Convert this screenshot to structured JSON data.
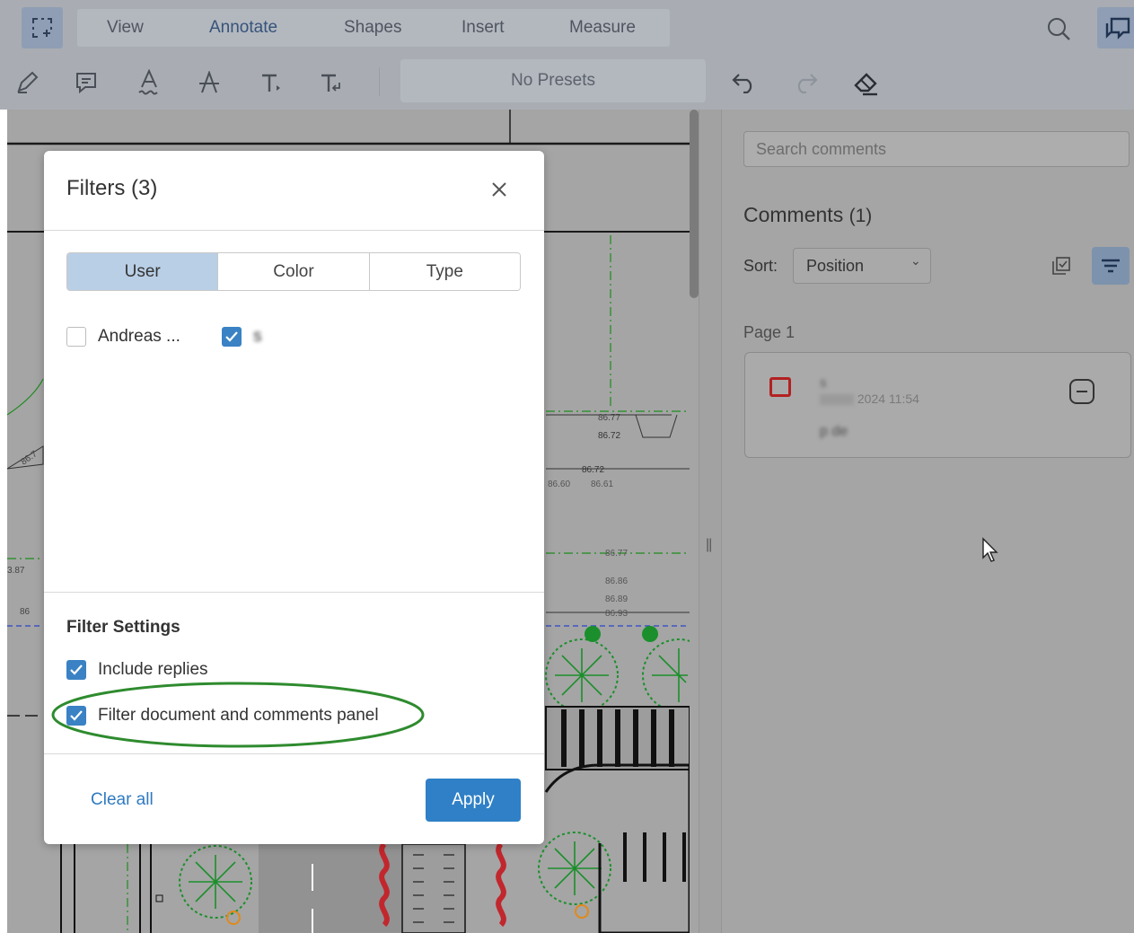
{
  "toolbar": {
    "menu": [
      "View",
      "Annotate",
      "Shapes",
      "Insert",
      "Measure"
    ],
    "active_menu": "Annotate",
    "presets_label": "No Presets",
    "icons": [
      "select-area-icon",
      "pen-icon",
      "comment-icon",
      "squiggly-text-icon",
      "strikeout-text-icon",
      "free-text-icon",
      "callout-text-icon",
      "undo-icon",
      "redo-icon",
      "eraser-icon",
      "search-icon",
      "comments-panel-icon"
    ]
  },
  "document": {
    "elevations": [
      "86.77",
      "86.72",
      "86.72",
      "86.60",
      "86.61",
      "86.77",
      "86.86",
      "86.89",
      "86.93",
      "86.7",
      "3.87",
      "86"
    ]
  },
  "comments_panel": {
    "search_placeholder": "Search comments",
    "title": "Comments",
    "count": "(1)",
    "sort_label": "Sort:",
    "sort_value": "Position",
    "page_label": "Page 1",
    "comment": {
      "author": "s",
      "date": "2024 11:54",
      "text": "p de"
    }
  },
  "filters_modal": {
    "title": "Filters (3)",
    "tabs": [
      "User",
      "Color",
      "Type"
    ],
    "active_tab": "User",
    "users": [
      {
        "name": "Andreas ...",
        "checked": false
      },
      {
        "name": "s",
        "checked": true
      }
    ],
    "settings_title": "Filter Settings",
    "settings": [
      {
        "label": "Include replies",
        "checked": true
      },
      {
        "label": "Filter document and comments panel",
        "checked": true
      }
    ],
    "clear_label": "Clear all",
    "apply_label": "Apply"
  },
  "colors": {
    "accent": "#2f80c6",
    "active_tab": "#b9cfe6",
    "highlight_ellipse": "#2e8b2e",
    "comment_rect": "#b32121"
  }
}
